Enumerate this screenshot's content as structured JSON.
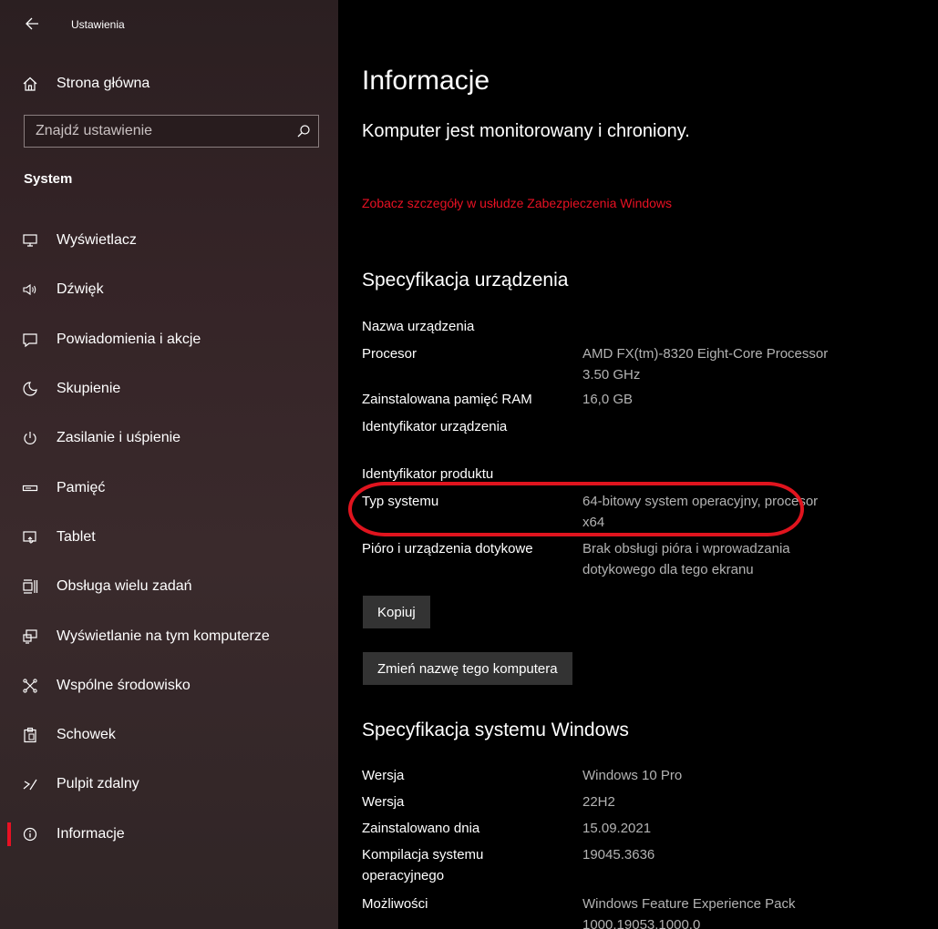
{
  "app": {
    "title": "Ustawienia"
  },
  "sidebar": {
    "home_label": "Strona główna",
    "search_placeholder": "Znajdź ustawienie",
    "section_title": "System",
    "items": [
      {
        "label": "Wyświetlacz",
        "icon": "monitor-icon"
      },
      {
        "label": "Dźwięk",
        "icon": "speaker-icon"
      },
      {
        "label": "Powiadomienia i akcje",
        "icon": "notification-icon"
      },
      {
        "label": "Skupienie",
        "icon": "moon-icon"
      },
      {
        "label": "Zasilanie i uśpienie",
        "icon": "power-icon"
      },
      {
        "label": "Pamięć",
        "icon": "storage-icon"
      },
      {
        "label": "Tablet",
        "icon": "tablet-icon"
      },
      {
        "label": "Obsługa wielu zadań",
        "icon": "multitasking-icon"
      },
      {
        "label": "Wyświetlanie na tym komputerze",
        "icon": "project-icon"
      },
      {
        "label": "Wspólne środowisko",
        "icon": "shared-experience-icon"
      },
      {
        "label": "Schowek",
        "icon": "clipboard-icon"
      },
      {
        "label": "Pulpit zdalny",
        "icon": "remote-desktop-icon"
      },
      {
        "label": "Informacje",
        "icon": "info-icon",
        "active": true
      }
    ]
  },
  "main": {
    "title": "Informacje",
    "protection_status": "Komputer jest monitorowany i chroniony.",
    "security_link": "Zobacz szczegóły w usłudze Zabezpieczenia Windows",
    "device_specs": {
      "heading": "Specyfikacja urządzenia",
      "rows": [
        {
          "label": "Nazwa urządzenia",
          "value": ""
        },
        {
          "label": "Procesor",
          "value": "AMD FX(tm)-8320 Eight-Core Processor 3.50 GHz"
        },
        {
          "label": "Zainstalowana pamięć RAM",
          "value": "16,0 GB"
        },
        {
          "label": "Identyfikator urządzenia",
          "value": ""
        },
        {
          "label": "Identyfikator produktu",
          "value": ""
        },
        {
          "label": "Typ systemu",
          "value": "64-bitowy system operacyjny, procesor x64"
        },
        {
          "label": "Pióro i urządzenia dotykowe",
          "value": "Brak obsługi pióra i wprowadzania dotykowego dla tego ekranu"
        }
      ],
      "copy_button": "Kopiuj",
      "rename_button": "Zmień nazwę tego komputera"
    },
    "windows_specs": {
      "heading": "Specyfikacja systemu Windows",
      "rows": [
        {
          "label": "Wersja",
          "value": "Windows 10 Pro"
        },
        {
          "label": "Wersja",
          "value": "22H2"
        },
        {
          "label": "Zainstalowano dnia",
          "value": "15.09.2021"
        },
        {
          "label": "Kompilacja systemu operacyjnego",
          "value": "19045.3636"
        },
        {
          "label": "Możliwości",
          "value": "Windows Feature Experience Pack 1000.19053.1000.0"
        }
      ]
    }
  },
  "colors": {
    "accent": "#e81123",
    "highlight_ring": "#e0141e",
    "main_background": "#000000",
    "value_text": "#b3b3b3"
  }
}
